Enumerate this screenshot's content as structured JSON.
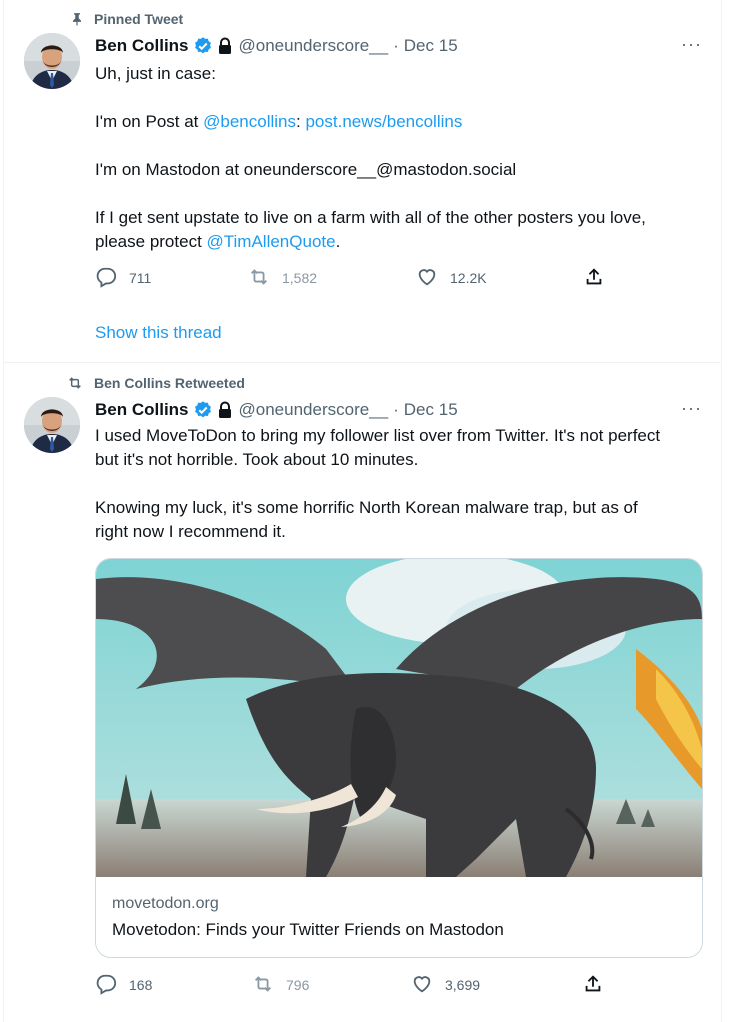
{
  "tweet1": {
    "context_label": "Pinned Tweet",
    "author": {
      "name": "Ben Collins",
      "handle": "@oneunderscore__",
      "date": "Dec 15"
    },
    "more_label": "···",
    "line1": "Uh, just in case:",
    "line2_prefix": "I'm on Post at ",
    "line2_mention": "@bencollins",
    "line2_colon": ": ",
    "line2_link": "post.news/bencollins",
    "line3": "I'm on Mastodon at oneunderscore__@mastodon.social",
    "line4": "If I get sent upstate to live on a farm with all of the other posters you love,",
    "line5_prefix": "please protect ",
    "line5_mention": "@TimAllenQuote",
    "line5_suffix": ".",
    "counts": {
      "replies": "711",
      "retweets": "1,582",
      "likes": "12.2K"
    },
    "show_thread": "Show this thread"
  },
  "tweet2": {
    "context_label": "Ben Collins Retweeted",
    "author": {
      "name": "Ben Collins",
      "handle": "@oneunderscore__",
      "date": "Dec 15"
    },
    "more_label": "···",
    "line1": "I used MoveToDon to bring my follower list over from Twitter. It's not perfect",
    "line2": "but it's not horrible. Took about 10 minutes.",
    "line3": "Knowing my luck, it's some horrific North Korean malware trap, but as of",
    "line4": "right now I recommend it.",
    "card": {
      "domain": "movetodon.org",
      "title": "Movetodon: Finds your Twitter Friends on Mastodon"
    },
    "counts": {
      "replies": "168",
      "retweets": "796",
      "likes": "3,699"
    }
  },
  "colors": {
    "accent": "#1d9bf0",
    "secondary_text": "#536471",
    "primary_text": "#0f1419",
    "border": "#eff3f4"
  },
  "icons": [
    "pin-icon",
    "verified-badge-icon",
    "lock-icon",
    "reply-icon",
    "retweet-icon",
    "like-icon",
    "share-icon",
    "more-icon"
  ]
}
